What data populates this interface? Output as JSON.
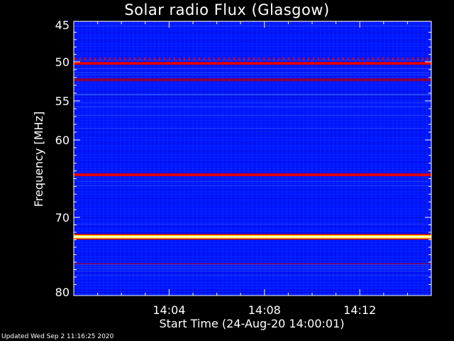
{
  "chart_data": {
    "type": "heatmap",
    "title": "Solar radio Flux (Glasgow)",
    "xlabel": "Start Time (24-Aug-20 14:00:01)",
    "ylabel": "Frequency [MHz]",
    "x_unit": "minutes since start",
    "xlim": [
      0.0,
      15.0
    ],
    "ylim": [
      45,
      80
    ],
    "y_inverted": true,
    "x_ticks": [
      {
        "value": 4,
        "label": "14:04"
      },
      {
        "value": 8,
        "label": "14:08"
      },
      {
        "value": 12,
        "label": "14:12"
      }
    ],
    "y_ticks": [
      {
        "value": 45,
        "label": "45"
      },
      {
        "value": 50,
        "label": "50"
      },
      {
        "value": 55,
        "label": "55"
      },
      {
        "value": 60,
        "label": "60"
      },
      {
        "value": 70,
        "label": "70"
      },
      {
        "value": 80,
        "label": "80"
      }
    ],
    "background_intensity": "blue",
    "bands": [
      {
        "freq": 49.6,
        "intensity": "red",
        "pattern": "dotted"
      },
      {
        "freq": 50.2,
        "intensity": "red",
        "pattern": "solid"
      },
      {
        "freq": 52.3,
        "intensity": "dark-red",
        "pattern": "solid"
      },
      {
        "freq": 54.2,
        "intensity": "light-blue",
        "pattern": "faint"
      },
      {
        "freq": 64.5,
        "intensity": "red",
        "pattern": "solid"
      },
      {
        "freq": 72.6,
        "intensity": "yellow-white",
        "pattern": "solid"
      },
      {
        "freq": 76.2,
        "intensity": "dark-red",
        "pattern": "faint"
      }
    ],
    "colors": {
      "background": "#000000",
      "low": "#0018ff",
      "dark_blue": "#0000c8",
      "light_blue": "#3c5cff",
      "dark_red": "#8a0044",
      "red": "#e00000",
      "yellow": "#ffe000",
      "white": "#ffffff"
    }
  },
  "footer": {
    "updated": "Updated Wed Sep  2 11:16:25 2020"
  }
}
